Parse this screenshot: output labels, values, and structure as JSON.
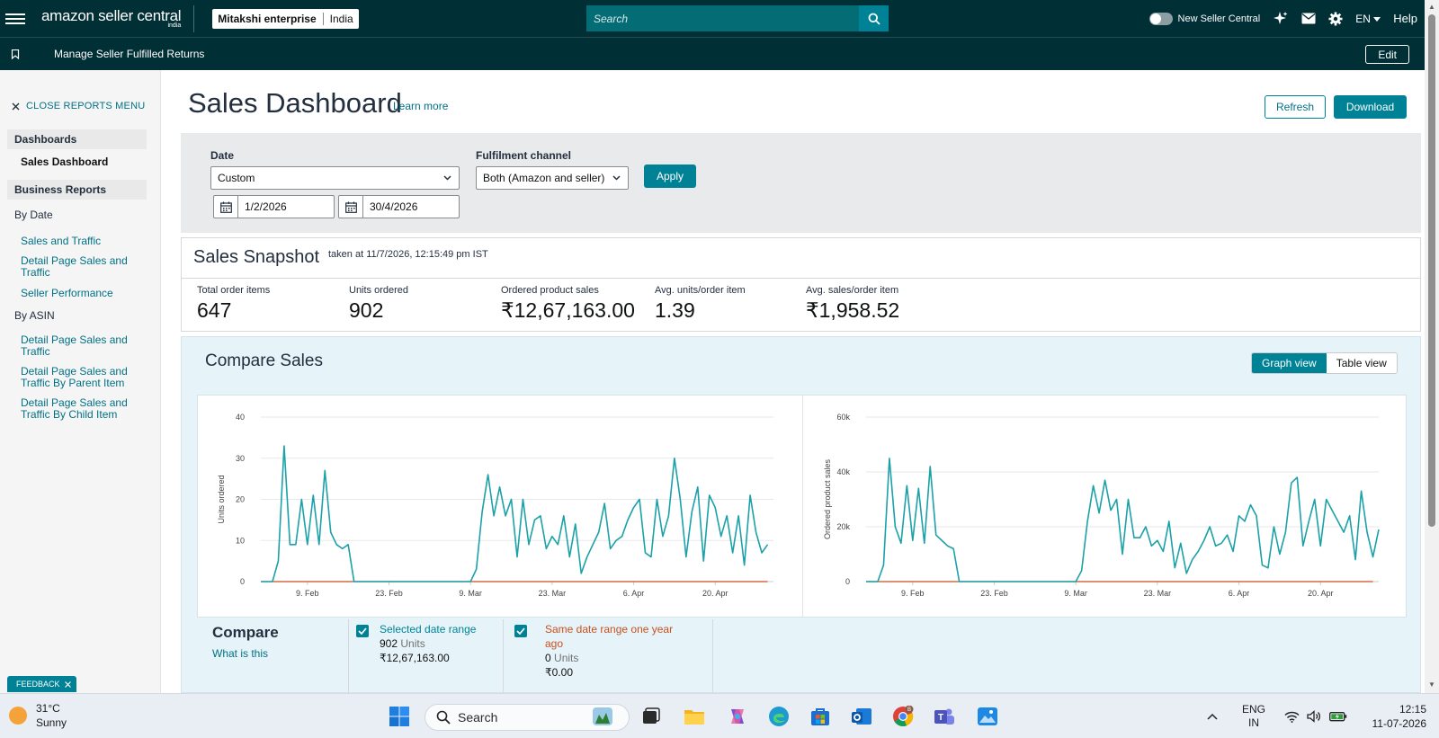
{
  "topnav": {
    "logo_main": "amazon seller central",
    "logo_sub": "india",
    "store_name": "Mitakshi enterprise",
    "marketplace": "India",
    "search_placeholder": "Search",
    "new_seller_central": "New Seller Central",
    "language": "EN",
    "help": "Help"
  },
  "subbar": {
    "link": "Manage Seller Fulfilled Returns",
    "edit": "Edit"
  },
  "sidebar": {
    "close_menu": "CLOSE REPORTS MENU",
    "dashboards_head": "Dashboards",
    "sales_dashboard": "Sales Dashboard",
    "business_reports_head": "Business Reports",
    "by_date": "By Date",
    "by_date_items": [
      "Sales and Traffic",
      "Detail Page Sales and Traffic",
      "Seller Performance"
    ],
    "by_asin": "By ASIN",
    "by_asin_items": [
      "Detail Page Sales and Traffic",
      "Detail Page Sales and Traffic By Parent Item",
      "Detail Page Sales and Traffic By Child Item"
    ]
  },
  "feedback": "FEEDBACK",
  "main": {
    "title": "Sales Dashboard",
    "learn_more": "Learn more",
    "refresh": "Refresh",
    "download": "Download"
  },
  "filters": {
    "date_label": "Date",
    "date_value": "Custom",
    "start_date": "1/2/2026",
    "end_date": "30/4/2026",
    "channel_label": "Fulfilment channel",
    "channel_value": "Both (Amazon and seller)",
    "apply": "Apply"
  },
  "snapshot": {
    "title": "Sales Snapshot",
    "taken_at": "taken at 11/7/2026, 12:15:49 pm IST",
    "metrics": [
      {
        "label": "Total order items",
        "value": "647"
      },
      {
        "label": "Units ordered",
        "value": "902"
      },
      {
        "label": "Ordered product sales",
        "value": "₹12,67,163.00"
      },
      {
        "label": "Avg. units/order item",
        "value": "1.39"
      },
      {
        "label": "Avg. sales/order item",
        "value": "₹1,958.52"
      }
    ]
  },
  "compare": {
    "title": "Compare Sales",
    "graph_view": "Graph view",
    "table_view": "Table view",
    "footer_title": "Compare",
    "what_is_this": "What is this",
    "selected_label": "Selected date range",
    "selected_units": "902",
    "selected_units_word": "Units",
    "selected_sales": "₹12,67,163.00",
    "prior_label": "Same date range one year ago",
    "prior_units": "0",
    "prior_units_word": "Units",
    "prior_sales": "₹0.00"
  },
  "colors": {
    "selected": "#1ba1a8",
    "prior": "#c7511f",
    "brand_dark": "#002f36",
    "teal": "#008296"
  },
  "chart_data": [
    {
      "type": "line",
      "ylabel": "Units ordered",
      "ylim": [
        0,
        40
      ],
      "yticks": [
        "0",
        "10",
        "20",
        "30",
        "40"
      ],
      "xticks": [
        "9. Feb",
        "23. Feb",
        "9. Mar",
        "23. Mar",
        "6. Apr",
        "20. Apr"
      ],
      "xtick_days": [
        8,
        22,
        36,
        50,
        64,
        78
      ],
      "x_days": [
        0,
        88
      ],
      "series": [
        {
          "color_key": "selected",
          "values": [
            0,
            0,
            0,
            5,
            33,
            9,
            9,
            20,
            9,
            21,
            9,
            27,
            12,
            9,
            8,
            9,
            0,
            0,
            0,
            0,
            0,
            0,
            0,
            0,
            0,
            0,
            0,
            0,
            0,
            0,
            0,
            0,
            0,
            0,
            0,
            0,
            0,
            3,
            17,
            26,
            16,
            23,
            16,
            20,
            6,
            20,
            9,
            15,
            16,
            8,
            11,
            9,
            16,
            6,
            14,
            2,
            6,
            9,
            12,
            19,
            8,
            10,
            11,
            15,
            18,
            20,
            7,
            6,
            20,
            11,
            16,
            30,
            20,
            6,
            17,
            23,
            5,
            21,
            18,
            11,
            16,
            7,
            16,
            4,
            21,
            12,
            7,
            9
          ]
        },
        {
          "color_key": "prior",
          "values": [
            0,
            0,
            0,
            0,
            0,
            0,
            0,
            0,
            0,
            0,
            0,
            0,
            0,
            0,
            0,
            0,
            0,
            0,
            0,
            0,
            0,
            0,
            0,
            0,
            0,
            0,
            0,
            0,
            0,
            0,
            0,
            0,
            0,
            0,
            0,
            0,
            0,
            0,
            0,
            0,
            0,
            0,
            0,
            0,
            0,
            0,
            0,
            0,
            0,
            0,
            0,
            0,
            0,
            0,
            0,
            0,
            0,
            0,
            0,
            0,
            0,
            0,
            0,
            0,
            0,
            0,
            0,
            0,
            0,
            0,
            0,
            0,
            0,
            0,
            0,
            0,
            0,
            0,
            0,
            0,
            0,
            0,
            0,
            0,
            0,
            0,
            0,
            0
          ]
        }
      ]
    },
    {
      "type": "line",
      "ylabel": "Ordered product sales",
      "ylim": [
        0,
        60000
      ],
      "yticks": [
        "0",
        "20k",
        "40k",
        "60k"
      ],
      "xticks": [
        "9. Feb",
        "23. Feb",
        "9. Mar",
        "23. Mar",
        "6. Apr",
        "20. Apr"
      ],
      "xtick_days": [
        8,
        22,
        36,
        50,
        64,
        78
      ],
      "x_days": [
        0,
        88
      ],
      "series": [
        {
          "color_key": "selected",
          "values": [
            0,
            0,
            0,
            6000,
            45000,
            20000,
            14000,
            35000,
            15000,
            34000,
            14000,
            42000,
            17000,
            15000,
            13000,
            12000,
            0,
            0,
            0,
            0,
            0,
            0,
            0,
            0,
            0,
            0,
            0,
            0,
            0,
            0,
            0,
            0,
            0,
            0,
            0,
            0,
            0,
            4000,
            22000,
            35000,
            25000,
            37000,
            26000,
            30000,
            10000,
            30000,
            16000,
            16000,
            20000,
            13000,
            15000,
            11000,
            22000,
            5000,
            14000,
            3000,
            8000,
            11000,
            15000,
            20000,
            13000,
            14000,
            17000,
            11000,
            24000,
            22000,
            28000,
            24000,
            6000,
            5000,
            20000,
            10000,
            18000,
            36000,
            38000,
            13000,
            22000,
            30000,
            13000,
            30000,
            26000,
            22000,
            18000,
            24000,
            8000,
            33000,
            18000,
            9000,
            19000
          ]
        },
        {
          "color_key": "prior",
          "values": [
            0,
            0,
            0,
            0,
            0,
            0,
            0,
            0,
            0,
            0,
            0,
            0,
            0,
            0,
            0,
            0,
            0,
            0,
            0,
            0,
            0,
            0,
            0,
            0,
            0,
            0,
            0,
            0,
            0,
            0,
            0,
            0,
            0,
            0,
            0,
            0,
            0,
            0,
            0,
            0,
            0,
            0,
            0,
            0,
            0,
            0,
            0,
            0,
            0,
            0,
            0,
            0,
            0,
            0,
            0,
            0,
            0,
            0,
            0,
            0,
            0,
            0,
            0,
            0,
            0,
            0,
            0,
            0,
            0,
            0,
            0,
            0,
            0,
            0,
            0,
            0,
            0,
            0,
            0,
            0,
            0,
            0,
            0,
            0,
            0,
            0,
            0,
            0
          ]
        }
      ]
    }
  ],
  "taskbar": {
    "temp": "31°C",
    "condition": "Sunny",
    "search": "Search",
    "lang_top": "ENG",
    "lang_bottom": "IN",
    "time": "12:15",
    "date": "11-07-2026",
    "chrome_badge": "B"
  }
}
